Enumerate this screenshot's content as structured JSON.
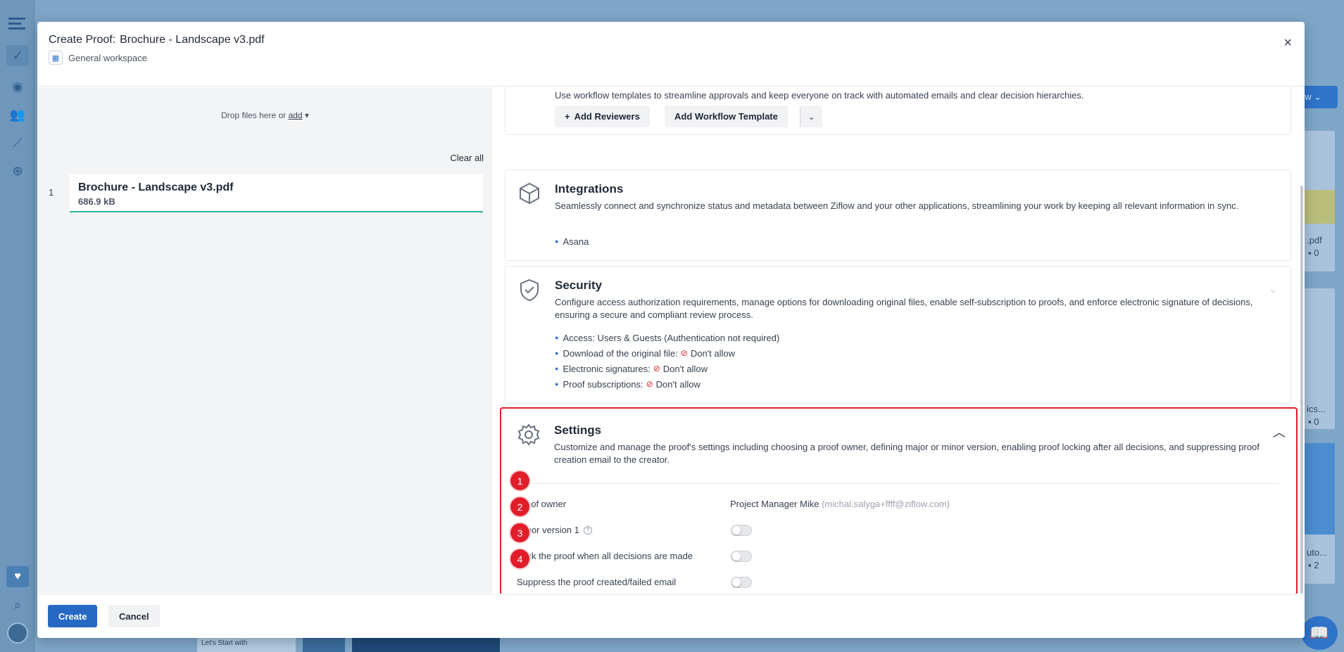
{
  "colors": {
    "accent": "#2669c4",
    "highlight": "#e11d2a",
    "file_underline": "#2bb59a"
  },
  "modal": {
    "title_prefix": "Create Proof:",
    "title_file": "Brochure - Landscape v3.pdf",
    "workspace": "General workspace",
    "close_icon": "×"
  },
  "upload": {
    "drop_text": "Drop files here or",
    "add_link": "add",
    "clear_all": "Clear all",
    "files": [
      {
        "index": "1",
        "name": "Brochure - Landscape v3.pdf",
        "size": "686.9 kB"
      }
    ]
  },
  "workflow": {
    "description": "Use workflow templates to streamline approvals and keep everyone on track with automated emails and clear decision hierarchies.",
    "add_reviewers": "Add Reviewers",
    "add_template": "Add Workflow Template"
  },
  "integrations": {
    "title": "Integrations",
    "description": "Seamlessly connect and synchronize status and metadata between Ziflow and your other applications, streamlining your work by keeping all relevant information in sync.",
    "items": [
      "Asana"
    ]
  },
  "security": {
    "title": "Security",
    "description": "Configure access authorization requirements, manage options for downloading original files, enable self-subscription to proofs, and enforce electronic signature of decisions, ensuring a secure and compliant review process.",
    "access": "Access: Users & Guests (Authentication not required)",
    "download_label": "Download of the original file:",
    "esign_label": "Electronic signatures:",
    "subs_label": "Proof subscriptions:",
    "dont_allow": "Don't allow"
  },
  "settings": {
    "title": "Settings",
    "description": "Customize and manage the proof's settings including choosing a proof owner, defining major or minor version, enabling proof locking after all decisions, and suppressing proof creation email to the creator.",
    "owner_label": "Proof owner",
    "owner_name": "Project Manager Mike",
    "owner_email": "(michal.salyga+ffff@ziflow.com)",
    "minor_label": "Minor version 1",
    "lock_label": "Lock the proof when all decisions are made",
    "suppress_label": "Suppress the proof created/failed email",
    "minor_on": false,
    "lock_on": false,
    "suppress_on": false,
    "badges": [
      "1",
      "2",
      "3",
      "4"
    ]
  },
  "footer": {
    "create": "Create",
    "cancel": "Cancel"
  },
  "background": {
    "new_button": "ew",
    "card1": ".pdf",
    "card1_count": "0",
    "card2": "ics...",
    "card2_count": "0",
    "card3": "uto...",
    "card3_count": "2",
    "strip_text": "Let's Start with"
  }
}
